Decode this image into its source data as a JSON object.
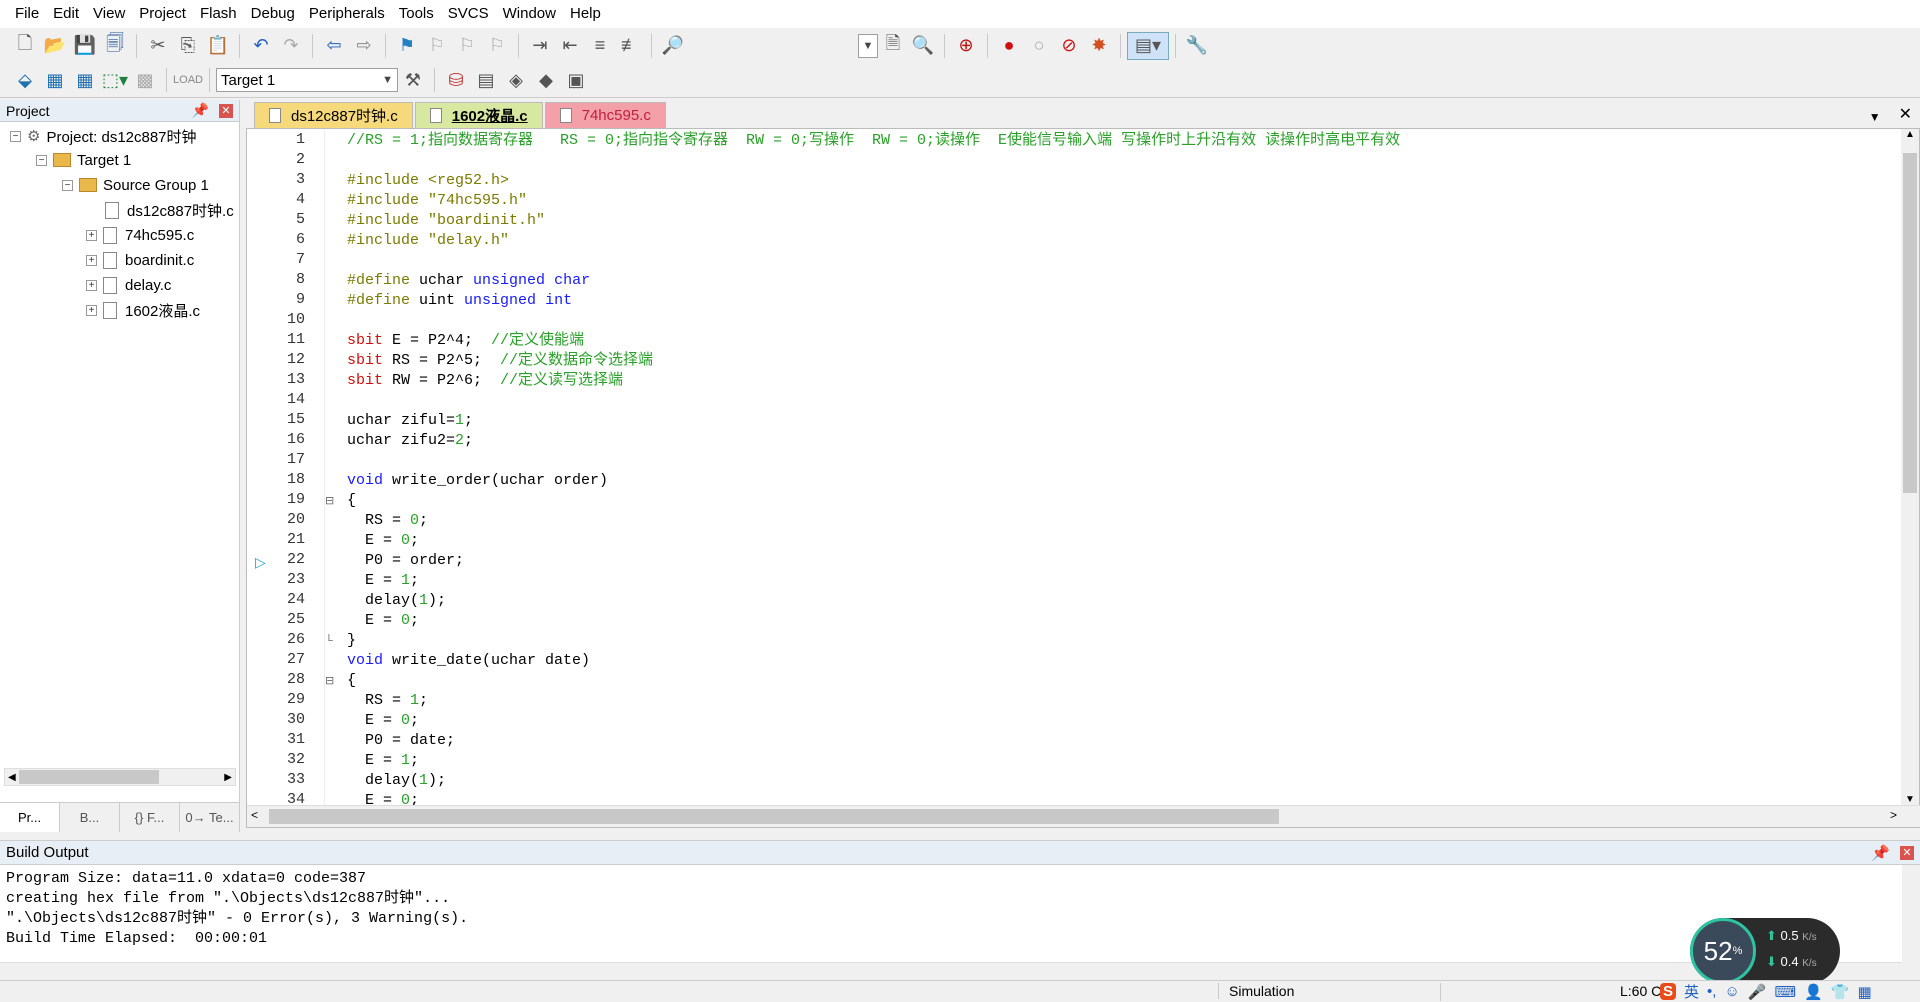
{
  "menu": [
    "File",
    "Edit",
    "View",
    "Project",
    "Flash",
    "Debug",
    "Peripherals",
    "Tools",
    "SVCS",
    "Window",
    "Help"
  ],
  "toolbar": {
    "target_combo": "Target 1"
  },
  "project": {
    "title": "Project",
    "root": "Project: ds12c887时钟",
    "target": "Target 1",
    "group": "Source Group 1",
    "files": [
      "ds12c887时钟.c",
      "74hc595.c",
      "boardinit.c",
      "delay.c",
      "1602液晶.c"
    ],
    "tabs": [
      "Pr...",
      "B...",
      "{} F...",
      "0→ Te..."
    ]
  },
  "editor": {
    "tabs": [
      {
        "label": "ds12c887时钟.c",
        "color": "#f6d97a"
      },
      {
        "label": "1602液晶.c",
        "color": "#d8e8a0"
      },
      {
        "label": "74hc595.c",
        "color": "#f4a0a8"
      }
    ],
    "line_numbers": [
      "1",
      "2",
      "3",
      "4",
      "5",
      "6",
      "7",
      "8",
      "9",
      "10",
      "11",
      "12",
      "13",
      "14",
      "15",
      "16",
      "17",
      "18",
      "19",
      "20",
      "21",
      "22",
      "23",
      "24",
      "25",
      "26",
      "27",
      "28",
      "29",
      "30",
      "31",
      "32",
      "33",
      "34"
    ]
  },
  "build_output": {
    "title": "Build Output",
    "lines": [
      "Program Size: data=11.0 xdata=0 code=387",
      "creating hex file from \".\\Objects\\ds12c887时钟\"...",
      "\".\\Objects\\ds12c887时钟\" - 0 Error(s), 3 Warning(s).",
      "Build Time Elapsed:  00:00:01"
    ]
  },
  "status": {
    "mode": "Simulation",
    "pos": "L:60 C:"
  },
  "net_widget": {
    "percent": "52",
    "unit": "%",
    "up": "0.5",
    "up_unit": "K/s",
    "down": "0.4",
    "down_unit": "K/s"
  },
  "ime": {
    "lang": "英"
  }
}
